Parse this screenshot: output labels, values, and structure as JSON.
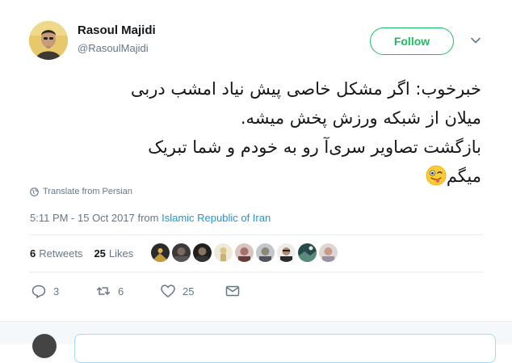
{
  "author": {
    "name": "Rasoul Majidi",
    "handle": "@RasoulMajidi"
  },
  "follow_button": {
    "label": "Follow"
  },
  "icons": {
    "caret": "chevron-down-icon",
    "translate": "globe-icon",
    "emoji": "winking-tongue-emoji-icon",
    "reply": "reply-icon",
    "retweet": "retweet-icon",
    "like": "heart-icon",
    "dm": "envelope-icon"
  },
  "tweet": {
    "lines": [
      "خبرخوب: اگر مشکل خاصی پیش نیاد امشب دربی",
      "میلان از شبکه ورزش پخش میشه.",
      "بازگشت تصاویر سری‌آ رو به خودم و شما تبریک",
      "میگم"
    ]
  },
  "translate": {
    "label": "Translate from Persian"
  },
  "meta": {
    "timestamp": "5:11 PM - 15 Oct 2017",
    "from_label": "from",
    "location": "Islamic Republic of Iran"
  },
  "stats": {
    "retweets_count": "6",
    "retweets_label": "Retweets",
    "likes_count": "25",
    "likes_label": "Likes"
  },
  "actions": {
    "reply_count": "3",
    "retweet_count": "6",
    "like_count": "25"
  },
  "colors": {
    "follow_green": "#17bf63",
    "link_blue": "#1b95e0",
    "muted": "#657786",
    "text": "#14171a",
    "divider": "#e6ecf0"
  }
}
